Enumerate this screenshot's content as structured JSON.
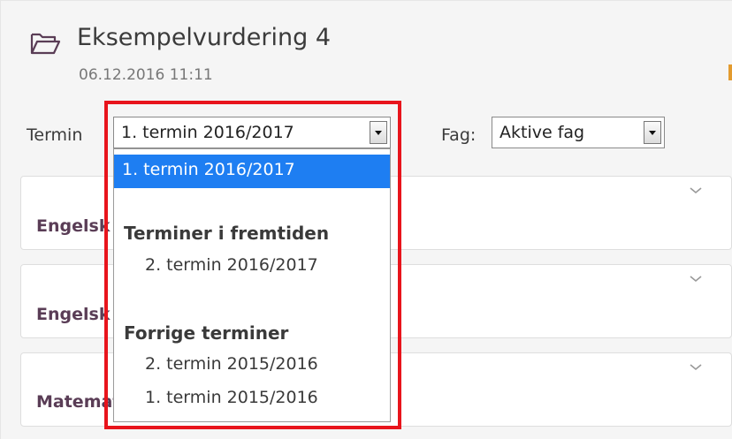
{
  "header": {
    "title": "Eksempelvurdering 4",
    "date": "06.12.2016 11:11",
    "icon": "folder-open-icon"
  },
  "filters": {
    "termin_label": "Termin",
    "termin_selected": "1. termin 2016/2017",
    "fag_label": "Fag:",
    "fag_selected": "Aktive fag"
  },
  "dropdown": {
    "selected_option": "1. termin 2016/2017",
    "groups": [
      {
        "label": "Terminer i fremtiden",
        "options": [
          "2. termin 2016/2017"
        ]
      },
      {
        "label": "Forrige terminer",
        "options": [
          "2. termin 2015/2016",
          "1. termin 2015/2016"
        ]
      }
    ]
  },
  "cards": [
    {
      "subject": "Engelsk"
    },
    {
      "subject": "Engelsk"
    },
    {
      "subject": "Matematikk"
    }
  ],
  "colors": {
    "selection": "#1e7ef2",
    "highlight_frame": "#e8141c",
    "subject_text": "#5a3d56",
    "accent": "#e39b2f"
  }
}
